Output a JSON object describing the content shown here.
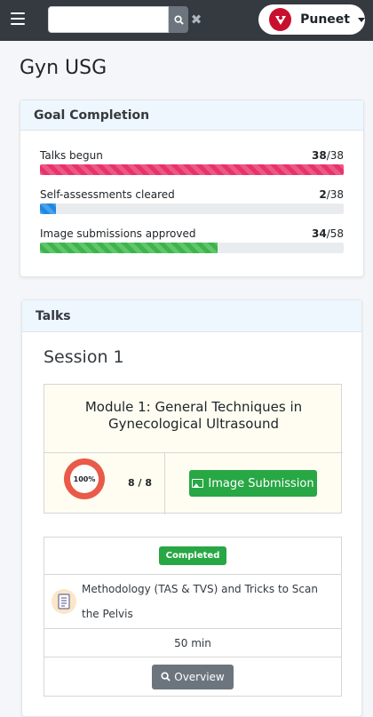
{
  "topbar": {
    "user_name": "Puneet"
  },
  "page": {
    "title": "Gyn USG"
  },
  "goal_completion": {
    "header": "Goal Completion",
    "rows": [
      {
        "label": "Talks begun",
        "done": "38",
        "total": "/38",
        "fraction": 1.0,
        "color": "#e8336a"
      },
      {
        "label": "Self-assessments cleared",
        "done": "2",
        "total": "/38",
        "fraction": 0.053,
        "color": "#1e88e5"
      },
      {
        "label": "Image submissions approved",
        "done": "34",
        "total": "/58",
        "fraction": 0.586,
        "color": "#3cb54a"
      }
    ]
  },
  "talks": {
    "header": "Talks",
    "session_title": "Session 1",
    "module": {
      "title": "Module 1: General Techniques in Gynecological Ultrasound",
      "progress_label": "100%",
      "progress_fraction": 1.0,
      "count": "8 / 8",
      "image_submission_label": "Image Submission"
    },
    "talk_item": {
      "status": "Completed",
      "name": "Methodology (TAS & TVS) and Tricks to Scan the Pelvis",
      "duration": "50 min",
      "overview_label": "Overview"
    }
  }
}
